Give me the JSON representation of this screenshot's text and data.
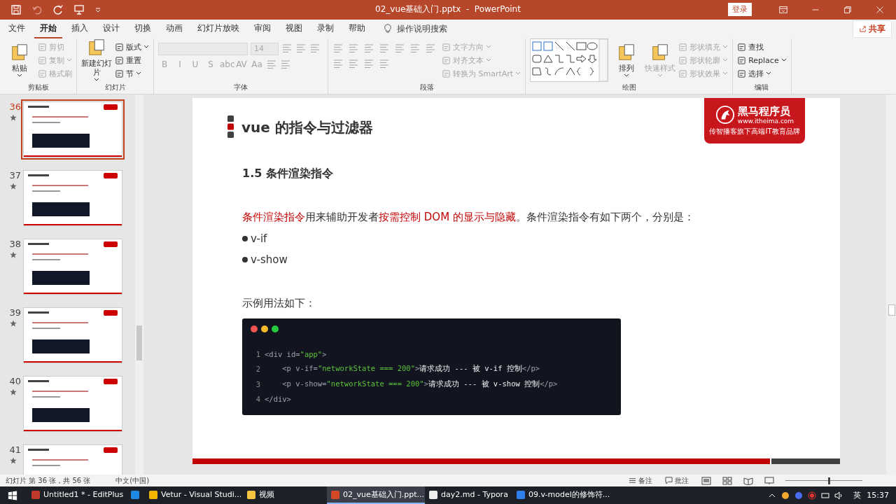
{
  "window": {
    "title": "02_vue基础入门.pptx  -  PowerPoint",
    "sign_in": "登录"
  },
  "menu": {
    "tabs": [
      {
        "label": "文件",
        "selected": false
      },
      {
        "label": "开始",
        "selected": true
      },
      {
        "label": "插入",
        "selected": false
      },
      {
        "label": "设计",
        "selected": false
      },
      {
        "label": "切换",
        "selected": false
      },
      {
        "label": "动画",
        "selected": false
      },
      {
        "label": "幻灯片放映",
        "selected": false
      },
      {
        "label": "审阅",
        "selected": false
      },
      {
        "label": "视图",
        "selected": false
      },
      {
        "label": "录制",
        "selected": false
      },
      {
        "label": "帮助",
        "selected": false
      }
    ],
    "search": "操作说明搜索",
    "share": "共享"
  },
  "ribbon": {
    "groups": [
      {
        "label": "剪贴板",
        "sections": [
          {
            "kind": "columns",
            "items": [
              {
                "kind": "large",
                "label": "粘贴",
                "disabled": false,
                "dropdown": true
              },
              {
                "kind": "small",
                "label": "剪切",
                "disabled": true,
                "dropdown": false
              },
              {
                "kind": "small",
                "label": "复制",
                "disabled": true,
                "dropdown": true
              },
              {
                "kind": "small",
                "label": "格式刷",
                "disabled": true,
                "dropdown": false
              }
            ]
          }
        ]
      },
      {
        "label": "幻灯片",
        "sections": [
          {
            "kind": "columns",
            "items": [
              {
                "kind": "large",
                "label": "新建幻灯片",
                "disabled": false,
                "dropdown": true
              },
              {
                "kind": "small",
                "label": "版式",
                "disabled": false,
                "dropdown": true
              },
              {
                "kind": "small",
                "label": "重置",
                "disabled": false,
                "dropdown": false
              },
              {
                "kind": "small",
                "label": "节",
                "disabled": false,
                "dropdown": true
              }
            ]
          }
        ]
      },
      {
        "label": "字体",
        "sections": [
          {
            "kind": "rows",
            "items": [
              {
                "kind": "field",
                "disabled": true
              },
              {
                "kind": "field",
                "value": "14",
                "disabled": true
              },
              {
                "kind": "tool",
                "disabled": true
              },
              {
                "kind": "tool",
                "disabled": true
              },
              {
                "kind": "tool",
                "disabled": true
              },
              {
                "kind": "glyph",
                "label": "B",
                "disabled": true
              },
              {
                "kind": "glyph",
                "label": "I",
                "disabled": true
              },
              {
                "kind": "glyph",
                "label": "U",
                "disabled": true
              },
              {
                "kind": "glyph",
                "label": "S",
                "disabled": true
              },
              {
                "kind": "glyph",
                "label": "abc",
                "disabled": true
              },
              {
                "kind": "glyph",
                "label": "AV",
                "disabled": true
              },
              {
                "kind": "glyph",
                "label": "Aa",
                "disabled": true
              },
              {
                "kind": "tool",
                "disabled": true
              },
              {
                "kind": "tool",
                "disabled": true
              }
            ]
          }
        ]
      },
      {
        "label": "段落",
        "sections": [
          {
            "kind": "rows",
            "items": [
              {
                "kind": "tool",
                "disabled": true
              },
              {
                "kind": "tool",
                "disabled": true
              },
              {
                "kind": "tool",
                "disabled": true
              },
              {
                "kind": "tool",
                "disabled": true
              },
              {
                "kind": "tool",
                "disabled": true
              },
              {
                "kind": "tool",
                "disabled": true
              },
              {
                "kind": "tool",
                "disabled": true
              },
              {
                "kind": "tool",
                "disabled": true
              },
              {
                "kind": "tool",
                "disabled": true
              },
              {
                "kind": "tool",
                "disabled": true
              },
              {
                "kind": "tool",
                "disabled": true
              }
            ]
          },
          {
            "kind": "columns",
            "items": [
              {
                "kind": "small",
                "label": "文字方向",
                "disabled": true,
                "dropdown": true
              },
              {
                "kind": "small",
                "label": "对齐文本",
                "disabled": true,
                "dropdown": true
              },
              {
                "kind": "small",
                "label": "转换为 SmartArt",
                "disabled": true,
                "dropdown": true
              }
            ]
          }
        ]
      },
      {
        "label": "绘图",
        "sections": [
          {
            "kind": "columns",
            "items": [
              {
                "kind": "gallery",
                "disabled": false
              },
              {
                "kind": "large",
                "label": "排列",
                "disabled": false,
                "dropdown": true
              },
              {
                "kind": "large",
                "label": "快速样式",
                "disabled": true,
                "dropdown": true
              },
              {
                "kind": "small",
                "label": "形状填充",
                "disabled": true,
                "dropdown": true
              },
              {
                "kind": "small",
                "label": "形状轮廓",
                "disabled": true,
                "dropdown": true
              },
              {
                "kind": "small",
                "label": "形状效果",
                "disabled": true,
                "dropdown": true
              }
            ]
          }
        ]
      },
      {
        "label": "编辑",
        "sections": [
          {
            "kind": "columns",
            "items": [
              {
                "kind": "small",
                "label": "查找",
                "disabled": false,
                "dropdown": false
              },
              {
                "kind": "small",
                "label": "Replace",
                "disabled": false,
                "dropdown": true
              },
              {
                "kind": "small",
                "label": "选择",
                "disabled": false,
                "dropdown": true
              }
            ]
          }
        ]
      }
    ]
  },
  "thumbnails": [
    {
      "number": "36",
      "selected": true
    },
    {
      "number": "37",
      "selected": false
    },
    {
      "number": "38",
      "selected": false
    },
    {
      "number": "39",
      "selected": false
    },
    {
      "number": "40",
      "selected": false
    },
    {
      "number": "41",
      "selected": false
    }
  ],
  "slide": {
    "title": "vue 的指令与过滤器",
    "logo": {
      "name": "黑马程序员",
      "url": "www.itheima.com",
      "tagline": "传智播客旗下高端IT教育品牌"
    },
    "heading": "1.5 条件渲染指令",
    "paragraph": [
      {
        "text": "条件渲染指令",
        "highlight": true
      },
      {
        "text": "用来辅助开发者",
        "highlight": false
      },
      {
        "text": "按需控制 DOM 的显示与隐藏",
        "highlight": true
      },
      {
        "text": "。条件渲染指令有如下两个，分别是：",
        "highlight": false
      }
    ],
    "bullets": [
      "v-if",
      "v-show"
    ],
    "example_label": "示例用法如下：",
    "code": [
      {
        "number": "1",
        "tokens": [
          {
            "kind": "tag",
            "text": "<div "
          },
          {
            "kind": "attr",
            "text": "id="
          },
          {
            "kind": "string",
            "text": "\"app\""
          },
          {
            "kind": "tag",
            "text": ">"
          }
        ]
      },
      {
        "number": "2",
        "tokens": [
          {
            "kind": "tag",
            "text": "    <p "
          },
          {
            "kind": "attr",
            "text": "v-if="
          },
          {
            "kind": "string",
            "text": "\"networkState === 200\""
          },
          {
            "kind": "tag",
            "text": ">"
          },
          {
            "kind": "text",
            "text": "请求成功 --- 被 v-if 控制"
          },
          {
            "kind": "tag",
            "text": "</p>"
          }
        ]
      },
      {
        "number": "3",
        "tokens": [
          {
            "kind": "tag",
            "text": "    <p "
          },
          {
            "kind": "attr",
            "text": "v-show="
          },
          {
            "kind": "string",
            "text": "\"networkState === 200\""
          },
          {
            "kind": "tag",
            "text": ">"
          },
          {
            "kind": "text",
            "text": "请求成功 --- 被 v-show 控制"
          },
          {
            "kind": "tag",
            "text": "</p>"
          }
        ]
      },
      {
        "number": "4",
        "tokens": [
          {
            "kind": "tag",
            "text": "</div>"
          }
        ]
      }
    ]
  },
  "status_bar": {
    "slide_info": "幻灯片 第 36 张，共 56 张",
    "language": "中文(中国)",
    "notes": "备注",
    "comments": "批注",
    "zoom": {
      "level": 0.55
    }
  },
  "taskbar": {
    "items": [
      {
        "label": "Untitled1 * - EditPlus",
        "color": "#c0392b",
        "selected": false
      },
      {
        "color": "#1e88e5",
        "selected": false
      },
      {
        "label": "Vetur - Visual Studi...",
        "color": "#f4b400",
        "selected": false
      },
      {
        "label": "视频",
        "color": "#f5c542",
        "selected": false
      },
      {
        "label": "02_vue基础入门.ppt...",
        "color": "#d24726",
        "selected": true
      },
      {
        "label": "day2.md - Typora",
        "color": "#eeeeee",
        "selected": false
      },
      {
        "label": "09.v-model的修饰符...",
        "color": "#2f80ed",
        "selected": false
      }
    ],
    "ime": "英",
    "time": "15:37"
  }
}
